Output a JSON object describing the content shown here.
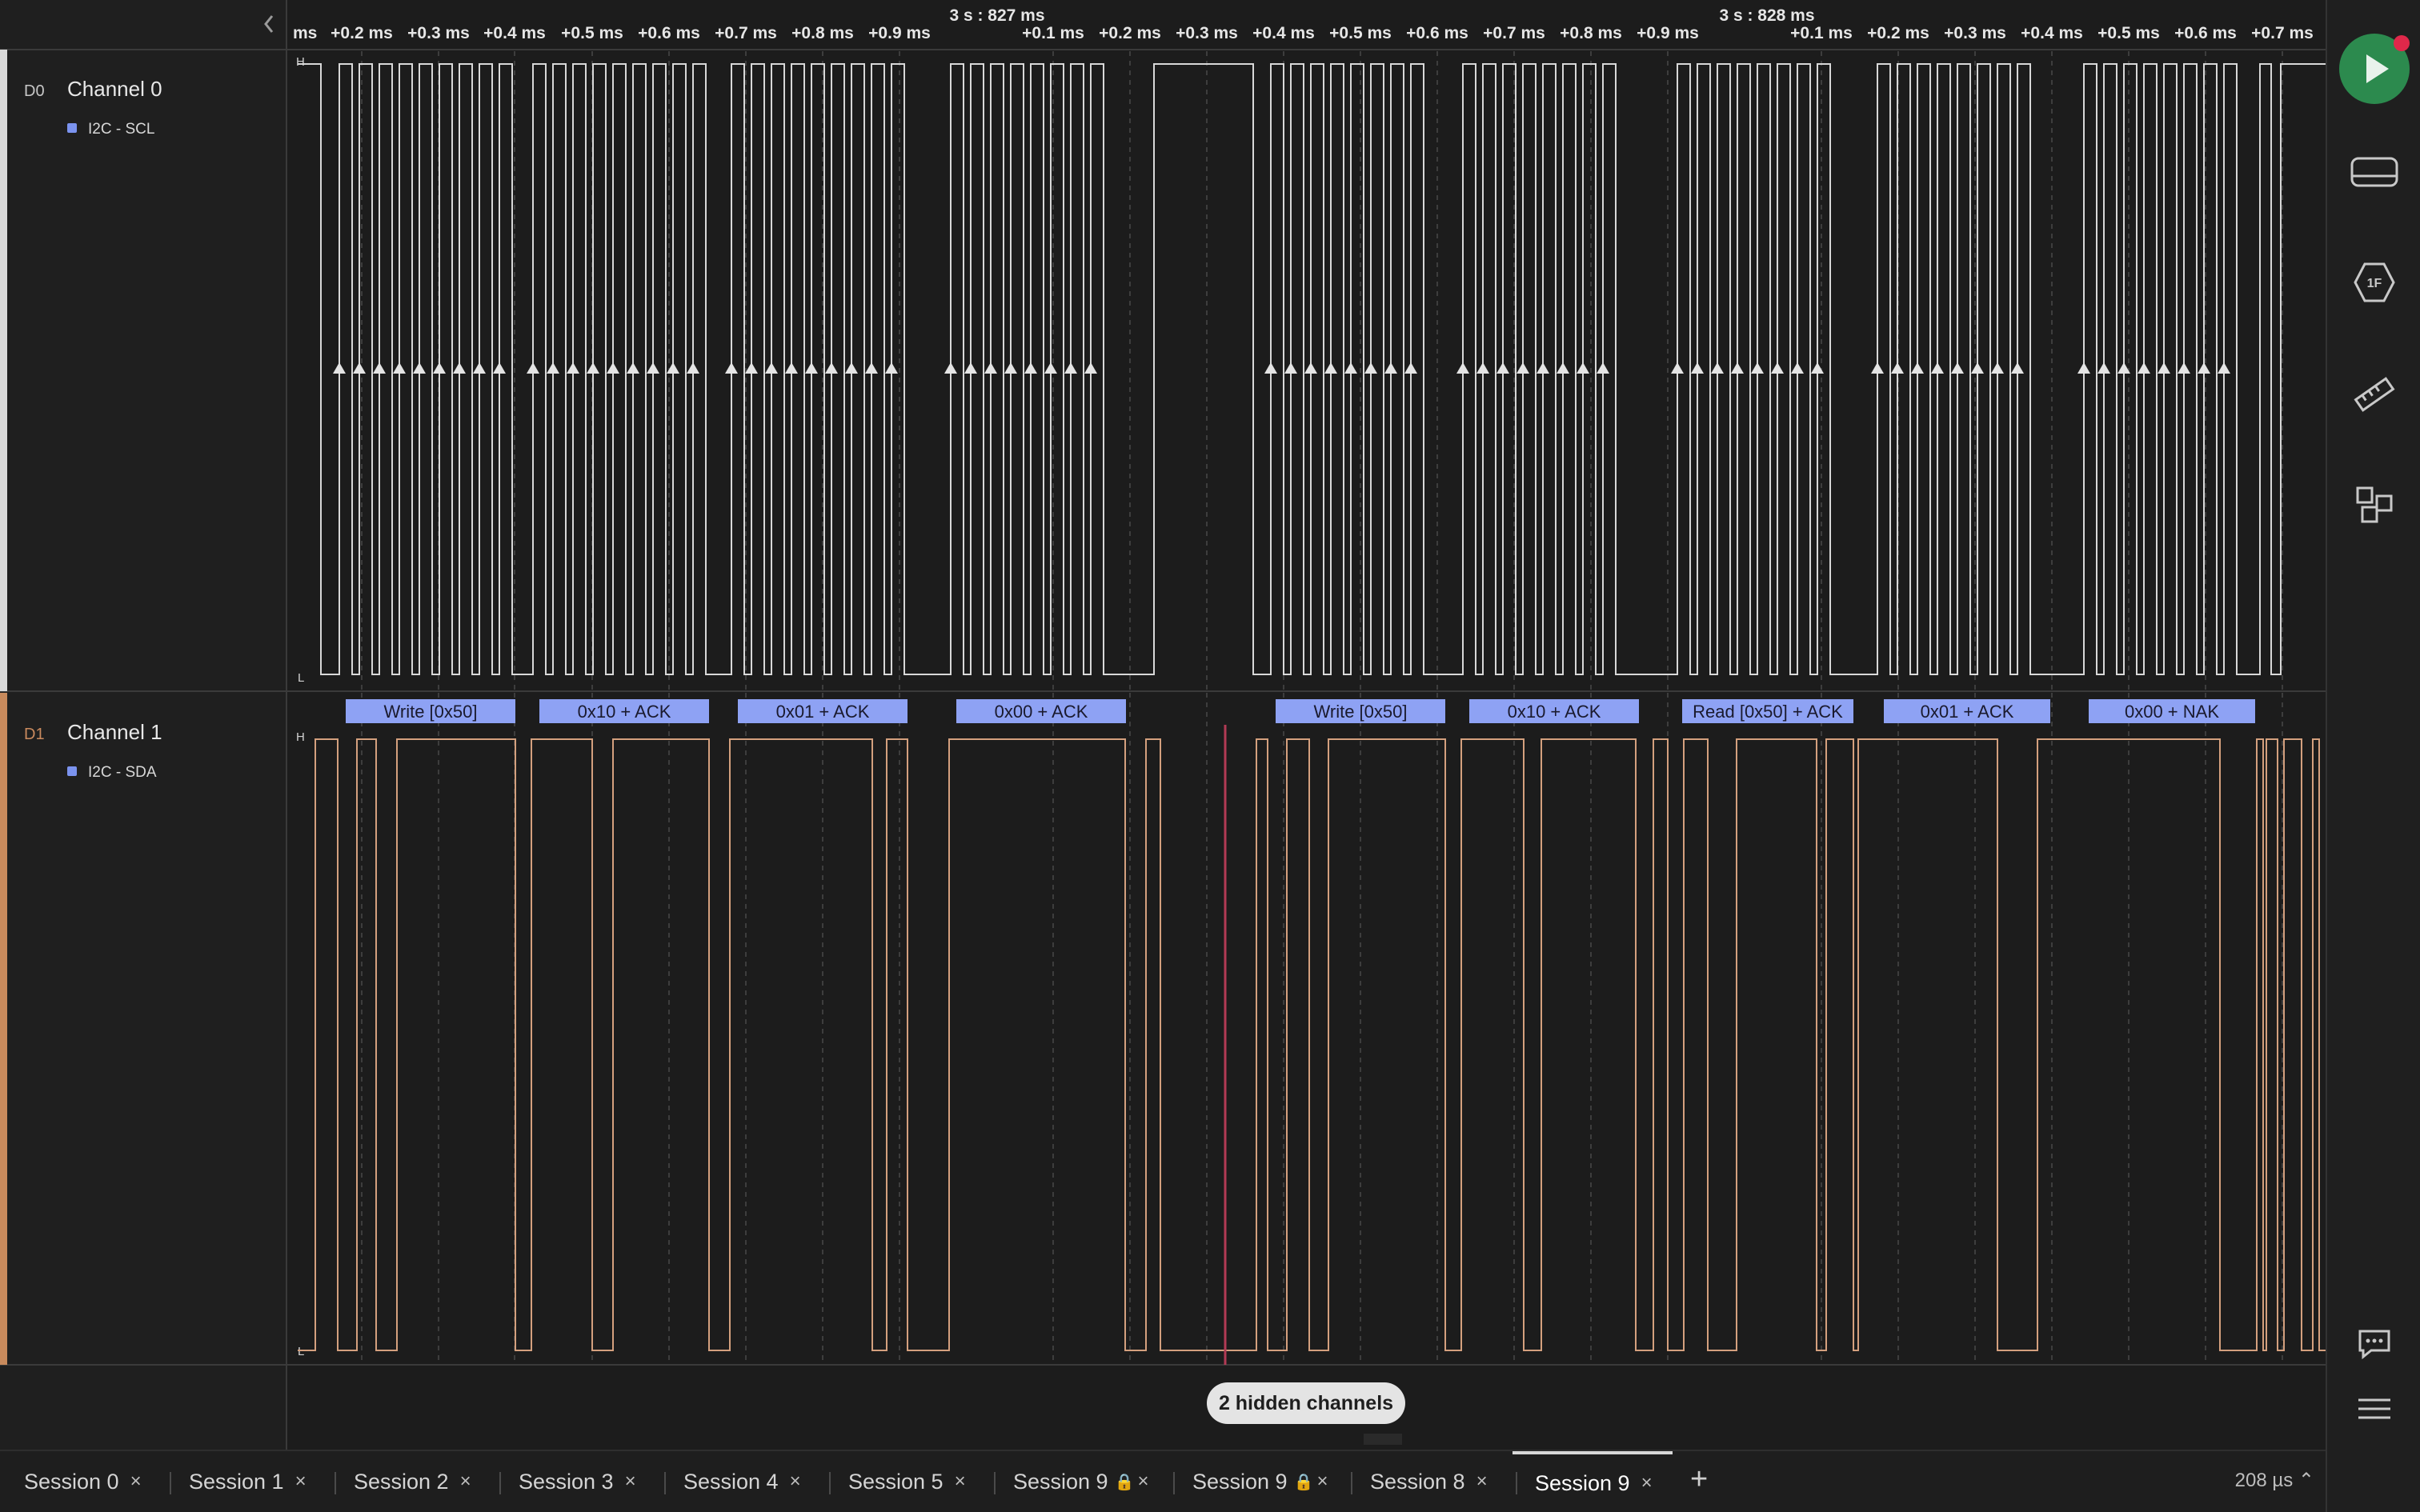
{
  "timeline": {
    "ticks": [
      "ms",
      "+0.2 ms",
      "+0.3 ms",
      "+0.4 ms",
      "+0.5 ms",
      "+0.6 ms",
      "+0.7 ms",
      "+0.8 ms",
      "+0.9 ms",
      "+0.1 ms",
      "+0.2 ms",
      "+0.3 ms",
      "+0.4 ms",
      "+0.5 ms",
      "+0.6 ms",
      "+0.7 ms",
      "+0.8 ms",
      "+0.9 ms",
      "+0.1 ms",
      "+0.2 ms",
      "+0.3 ms",
      "+0.4 ms",
      "+0.5 ms",
      "+0.6 ms",
      "+0.7 ms"
    ],
    "markers": [
      "3 s : 827 ms",
      "3 s : 828 ms"
    ]
  },
  "channels": [
    {
      "id": "D0",
      "name": "Channel 0",
      "analyzer": "I2C - SCL",
      "accent": "#d9d9d9",
      "wave": "#d8d8d8",
      "tag": "#7b93ef"
    },
    {
      "id": "D1",
      "name": "Channel 1",
      "analyzer": "I2C - SDA",
      "accent": "#c88a5c",
      "wave": "#d4a07e",
      "tag": "#7b93ef"
    }
  ],
  "levels": {
    "high": "H",
    "low": "L"
  },
  "decoded": [
    "Write [0x50]",
    "0x10 + ACK",
    "0x01 + ACK",
    "0x00 + ACK",
    "Write [0x50]",
    "0x10 + ACK",
    "Read [0x50] + ACK",
    "0x01 + ACK",
    "0x00 + NAK"
  ],
  "decoded_color": "#8ea2f4",
  "cursor_color": "#b23a55",
  "hidden_channels": "2 hidden channels",
  "tabs": [
    {
      "label": "Session 0",
      "locked": false,
      "active": false
    },
    {
      "label": "Session 1",
      "locked": false,
      "active": false
    },
    {
      "label": "Session 2",
      "locked": false,
      "active": false
    },
    {
      "label": "Session 3",
      "locked": false,
      "active": false
    },
    {
      "label": "Session 4",
      "locked": false,
      "active": false
    },
    {
      "label": "Session 5",
      "locked": false,
      "active": false
    },
    {
      "label": "Session 9",
      "locked": true,
      "active": false
    },
    {
      "label": "Session 9",
      "locked": true,
      "active": false
    },
    {
      "label": "Session 8",
      "locked": false,
      "active": false
    },
    {
      "label": "Session 9",
      "locked": false,
      "active": true
    }
  ],
  "zoom": "208 µs",
  "rail_icons": [
    "play-icon",
    "device-icon",
    "trigger-icon",
    "measure-icon",
    "extensions-icon",
    "chat-icon",
    "menu-icon"
  ],
  "run_color": "#2c8a4e"
}
